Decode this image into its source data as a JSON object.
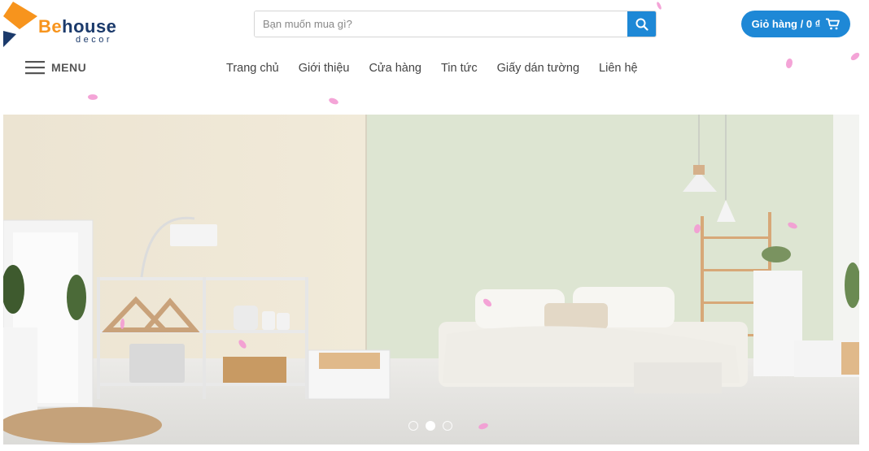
{
  "logo": {
    "brand_part1": "Be",
    "brand_part2": "house",
    "sub": "decor"
  },
  "search": {
    "placeholder": "Bạn muốn mua gì?"
  },
  "cart": {
    "label": "Giỏ hàng / 0 ₫"
  },
  "menu": {
    "label": "MENU"
  },
  "nav": {
    "items": [
      {
        "label": "Trang chủ"
      },
      {
        "label": "Giới thiệu"
      },
      {
        "label": "Cửa hàng"
      },
      {
        "label": "Tin tức"
      },
      {
        "label": "Giấy dán tường"
      },
      {
        "label": "Liên hệ"
      }
    ]
  },
  "slider": {
    "slide_count": 3,
    "active_index": 1
  },
  "colors": {
    "accent": "#1e88d6",
    "brand_orange": "#f7941d",
    "brand_navy": "#1b3a6b",
    "petal": "#f39ad3"
  }
}
